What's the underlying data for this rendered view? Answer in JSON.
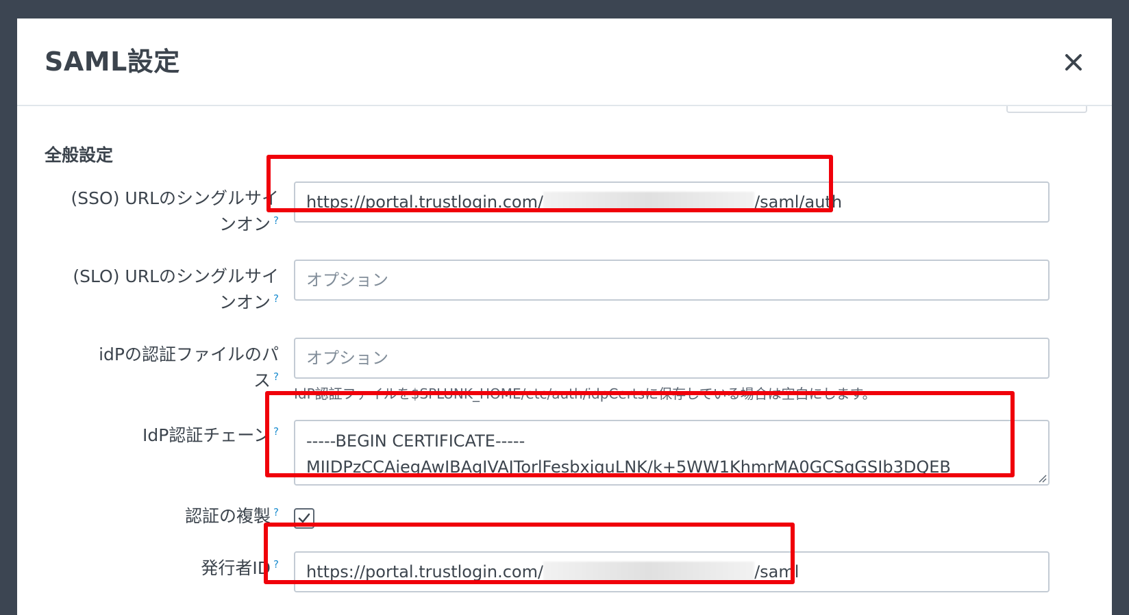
{
  "modal": {
    "title": "SAML設定",
    "close_icon": "close-icon"
  },
  "section": {
    "title": "全般設定"
  },
  "fields": {
    "sso_url": {
      "label_line1": "(SSO) URLのシングルサイ",
      "label_line2": "ンオン",
      "value_prefix": "https://portal.trustlogin.com/",
      "value_suffix": "/saml/auth"
    },
    "slo_url": {
      "label_line1": "(SLO) URLのシングルサイ",
      "label_line2": "ンオン",
      "placeholder": "オプション"
    },
    "idp_cert_path": {
      "label_line1": "idPの認証ファイルのパ",
      "label_line2": "ス",
      "placeholder": "オプション",
      "help_text": "IdP認証ファイルを$SPLUNK_HOME/etc/auth/idpCertsに保存している場合は空白にします。"
    },
    "idp_cert_chain": {
      "label": "IdP認証チェーン",
      "line1": "-----BEGIN CERTIFICATE-----",
      "line2": "MIIDPzCCAiegAwIBAgIVAJTorlFesbxjquLNK/k+5WW1KhmrMA0GCSqGSIb3DQEB"
    },
    "replicate_certs": {
      "label": "認証の複製",
      "checked": true
    },
    "issuer_id": {
      "label": "発行者ID",
      "value_prefix": "https://portal.trustlogin.com/",
      "value_suffix": "/saml"
    }
  },
  "help_marker": "?",
  "colors": {
    "highlight": "#f0000a",
    "help_link": "#1a8ccf",
    "backdrop": "#3c4552"
  }
}
